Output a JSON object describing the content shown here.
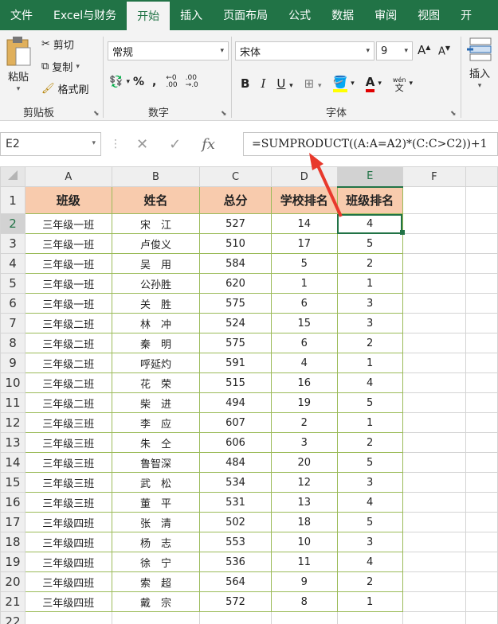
{
  "tabs": [
    "文件",
    "Excel与财务",
    "开始",
    "插入",
    "页面布局",
    "公式",
    "数据",
    "审阅",
    "视图",
    "开"
  ],
  "active_tab": "开始",
  "ribbon": {
    "paste": "粘贴",
    "cut": "剪切",
    "copy": "复制",
    "format_painter": "格式刷",
    "clipboard": "剪贴板",
    "number_format": "常规",
    "number": "数字",
    "font_name": "宋体",
    "font_size": "9",
    "font": "字体",
    "insert": "插入",
    "pinyin": "wén"
  },
  "formula_bar": {
    "name_box": "E2",
    "formula": "=SUMPRODUCT((A:A=A2)*(C:C>C2))+1"
  },
  "columns": [
    "A",
    "B",
    "C",
    "D",
    "E",
    "F"
  ],
  "headers": [
    "班级",
    "姓名",
    "总分",
    "学校排名",
    "班级排名"
  ],
  "rows": [
    [
      "三年级一班",
      "宋　江",
      "527",
      "14",
      "4"
    ],
    [
      "三年级一班",
      "卢俊义",
      "510",
      "17",
      "5"
    ],
    [
      "三年级一班",
      "吴　用",
      "584",
      "5",
      "2"
    ],
    [
      "三年级一班",
      "公孙胜",
      "620",
      "1",
      "1"
    ],
    [
      "三年级一班",
      "关　胜",
      "575",
      "6",
      "3"
    ],
    [
      "三年级二班",
      "林　冲",
      "524",
      "15",
      "3"
    ],
    [
      "三年级二班",
      "秦　明",
      "575",
      "6",
      "2"
    ],
    [
      "三年级二班",
      "呼延灼",
      "591",
      "4",
      "1"
    ],
    [
      "三年级二班",
      "花　荣",
      "515",
      "16",
      "4"
    ],
    [
      "三年级二班",
      "柴　进",
      "494",
      "19",
      "5"
    ],
    [
      "三年级三班",
      "李　应",
      "607",
      "2",
      "1"
    ],
    [
      "三年级三班",
      "朱　仝",
      "606",
      "3",
      "2"
    ],
    [
      "三年级三班",
      "鲁智深",
      "484",
      "20",
      "5"
    ],
    [
      "三年级三班",
      "武　松",
      "534",
      "12",
      "3"
    ],
    [
      "三年级三班",
      "董　平",
      "531",
      "13",
      "4"
    ],
    [
      "三年级四班",
      "张　清",
      "502",
      "18",
      "5"
    ],
    [
      "三年级四班",
      "杨　志",
      "553",
      "10",
      "3"
    ],
    [
      "三年级四班",
      "徐　宁",
      "536",
      "11",
      "4"
    ],
    [
      "三年级四班",
      "索　超",
      "564",
      "9",
      "2"
    ],
    [
      "三年级四班",
      "戴　宗",
      "572",
      "8",
      "1"
    ]
  ],
  "row_numbers": [
    "1",
    "2",
    "3",
    "4",
    "5",
    "6",
    "7",
    "8",
    "9",
    "10",
    "11",
    "12",
    "13",
    "14",
    "15",
    "16",
    "17",
    "18",
    "19",
    "20",
    "21",
    "22"
  ],
  "colors": {
    "accent": "#217346",
    "header_fill": "#f8cbad",
    "table_border": "#9bbb59",
    "arrow": "#e8392c"
  }
}
